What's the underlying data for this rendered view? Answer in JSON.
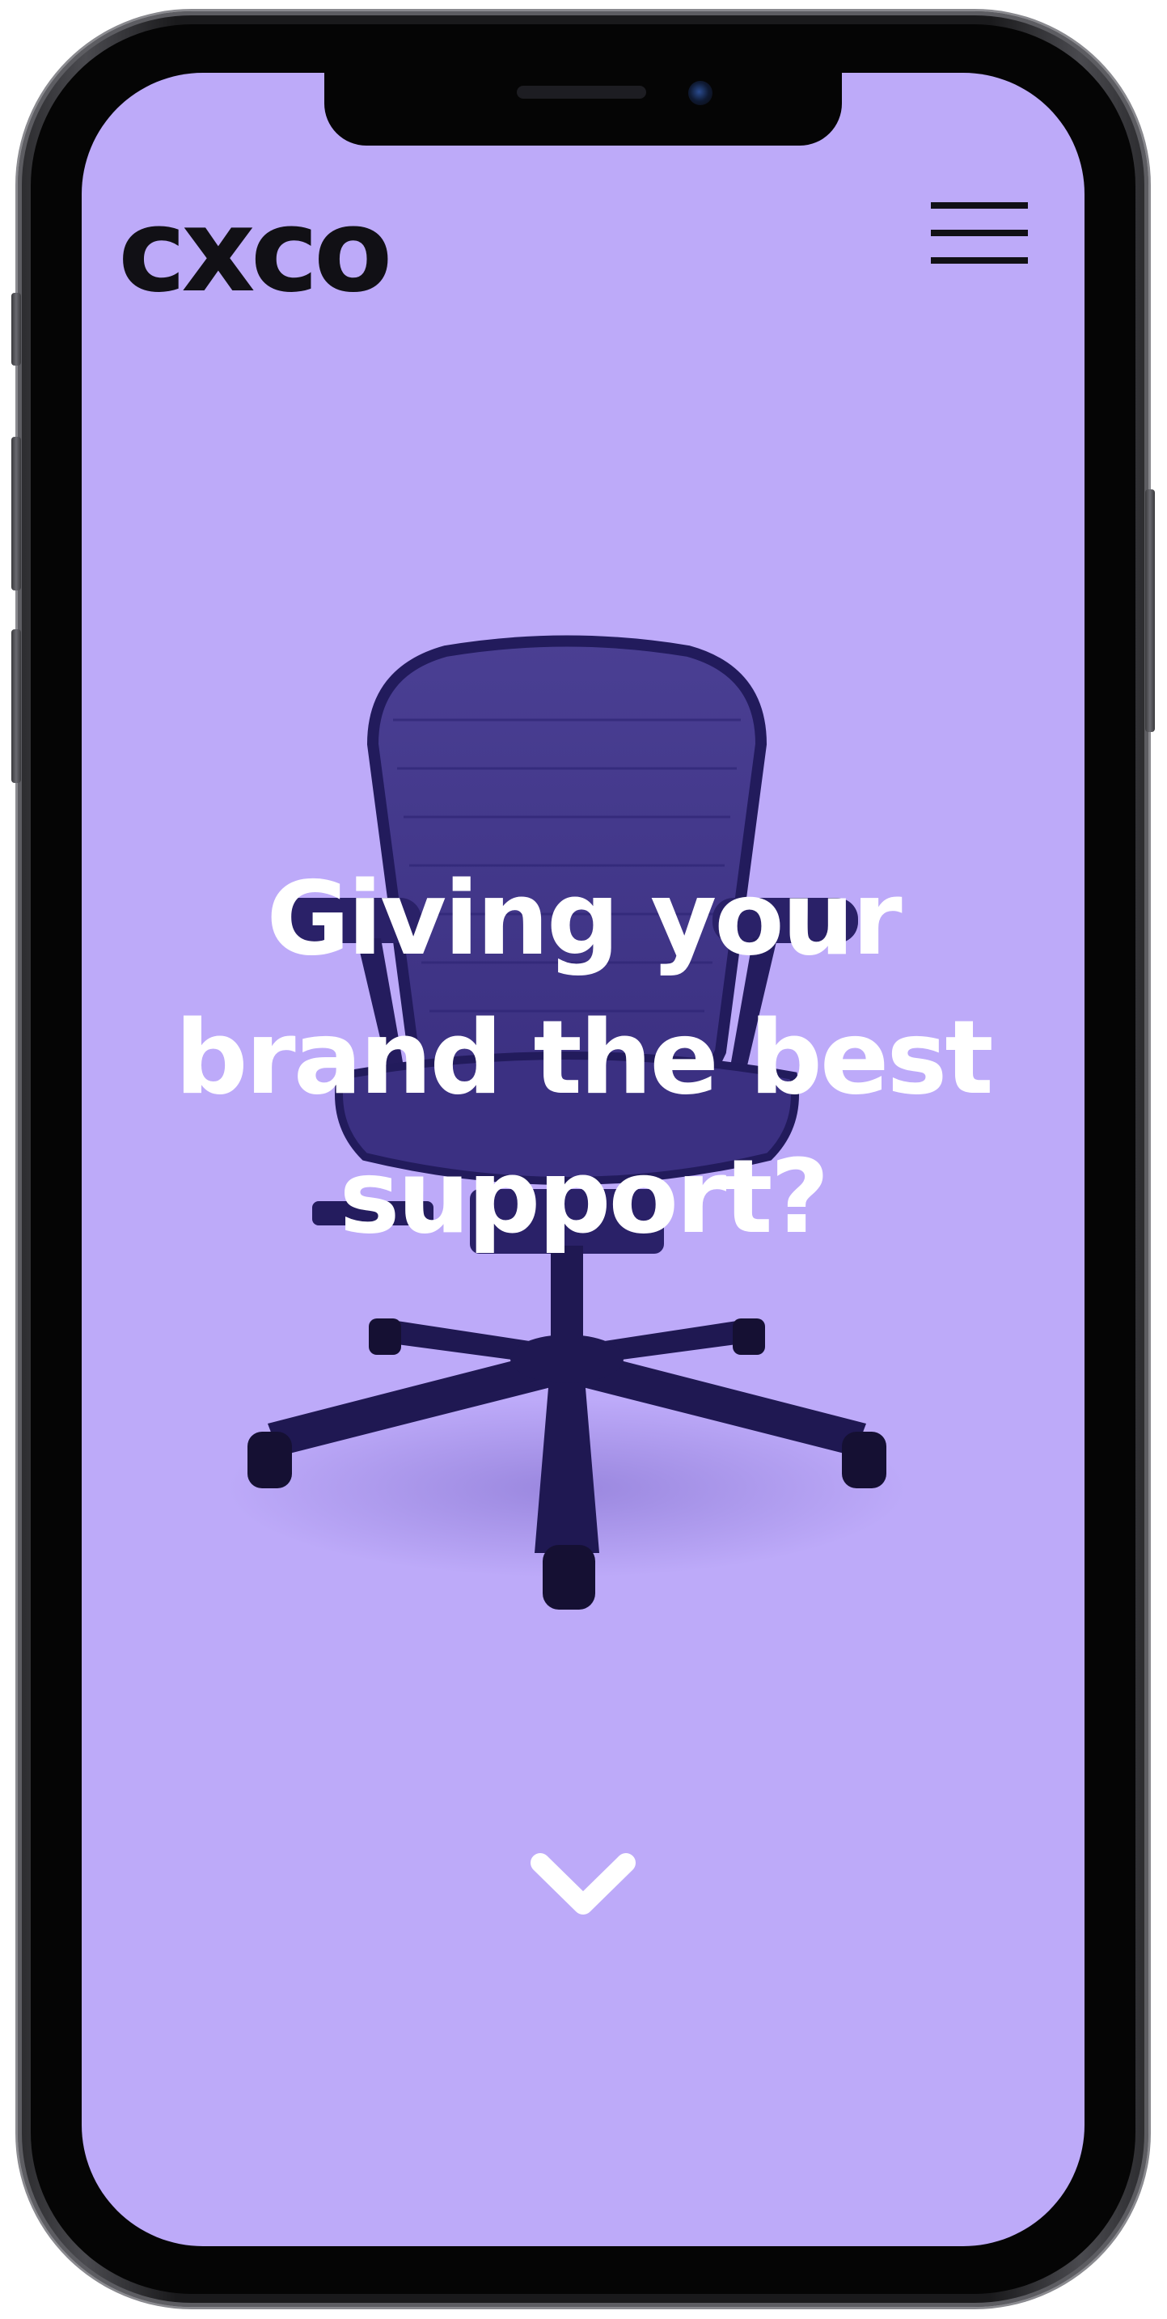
{
  "brand": {
    "logo_text": "cxco"
  },
  "header": {
    "menu_icon": "hamburger-menu-icon"
  },
  "hero": {
    "headline_lines": [
      "Giving your",
      "brand the best",
      "support?"
    ],
    "image": "office-chair",
    "scroll_icon": "chevron-down-icon"
  },
  "colors": {
    "background": "#bdaaf9",
    "chair": "#2d2470",
    "text": "#ffffff",
    "logo": "#111015"
  }
}
